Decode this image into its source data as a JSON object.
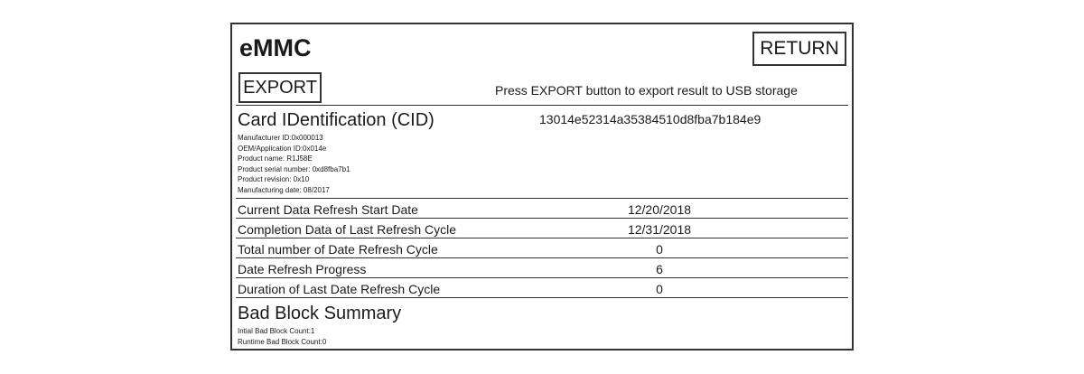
{
  "header": {
    "title": "eMMC",
    "return_label": "RETURN",
    "export_label": "EXPORT",
    "export_hint": "Press EXPORT button to export result to USB storage"
  },
  "cid": {
    "title": "Card IDentification (CID)",
    "value": "13014e52314a35384510d8fba7b184e9",
    "details": [
      "Manufacturer ID:0x000013",
      "OEM/Application ID:0x014e",
      "Product name: R1J58E",
      "Product serial number: 0xd8fba7b1",
      "Product revision: 0x10",
      "Manufacturing date: 08/2017"
    ]
  },
  "rows": [
    {
      "label": "Current Data Refresh Start Date",
      "value": "12/20/2018"
    },
    {
      "label": "Completion Data of Last Refresh Cycle",
      "value": "12/31/2018"
    },
    {
      "label": "Total number of Date Refresh Cycle",
      "value": "0"
    },
    {
      "label": "Date Refresh Progress",
      "value": "6"
    },
    {
      "label": "Duration of Last Date Refresh Cycle",
      "value": "0"
    }
  ],
  "bad_block": {
    "title": "Bad Block Summary",
    "details": [
      "Intial Bad Block Count:1",
      "Runtime Bad Block Count:0"
    ]
  }
}
